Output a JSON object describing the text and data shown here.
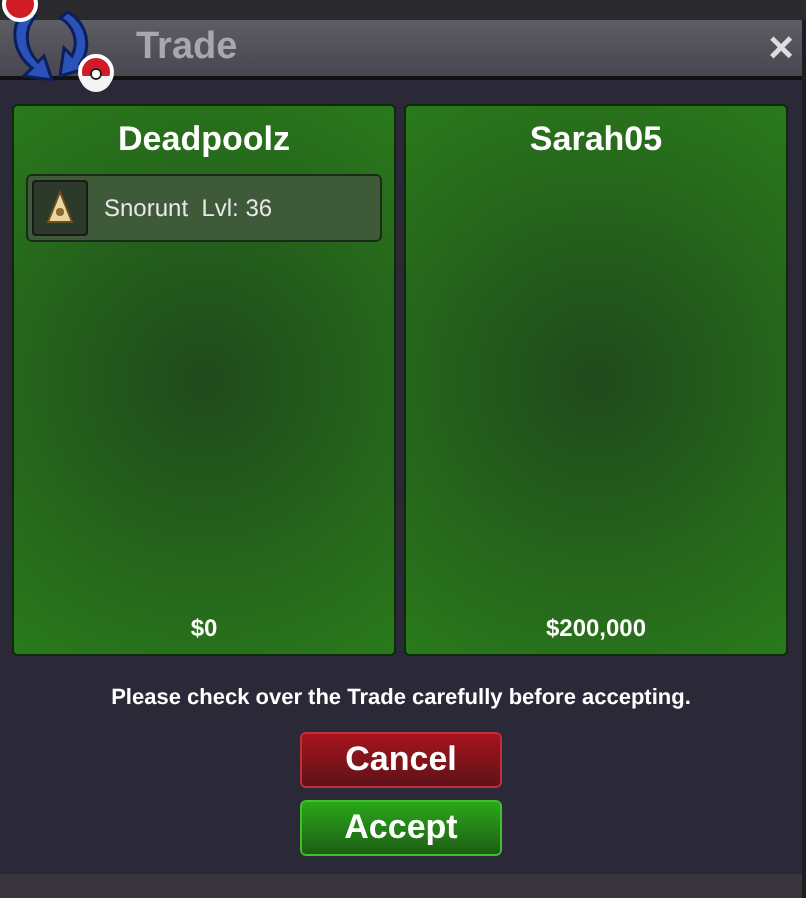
{
  "window": {
    "title": "Trade",
    "close": "×"
  },
  "traders": [
    {
      "name": "Deadpoolz",
      "items": [
        {
          "label": "Snorunt  Lvl: 36"
        }
      ],
      "money": "$0"
    },
    {
      "name": "Sarah05",
      "money": "$200,000"
    }
  ],
  "notice": "Please check over the Trade carefully before accepting.",
  "buttons": [
    {
      "label": "Cancel",
      "kind": "cancel"
    },
    {
      "label": "Accept",
      "kind": "accept"
    }
  ]
}
